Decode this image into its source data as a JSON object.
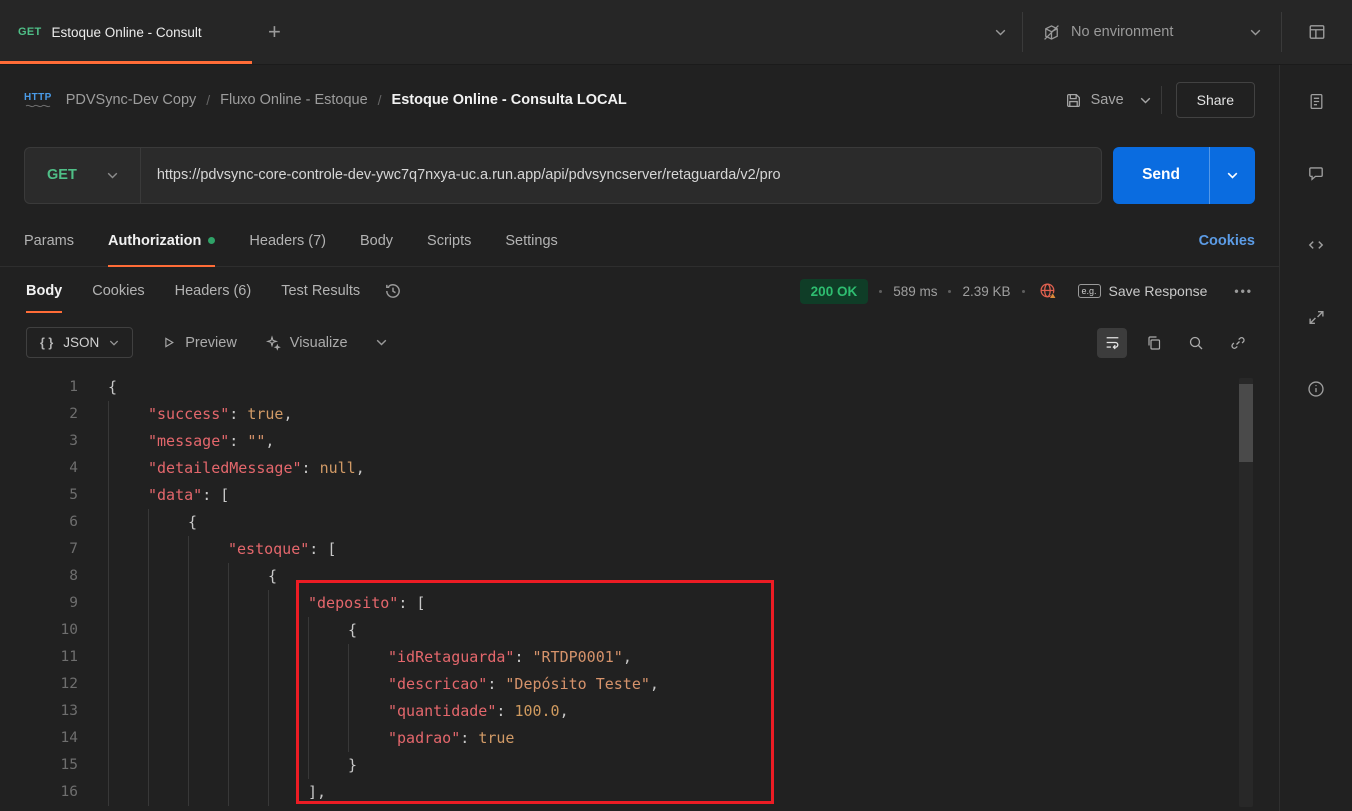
{
  "topbar": {
    "tab": {
      "method": "GET",
      "title": "Estoque Online - Consult"
    },
    "add_label": "+",
    "environment": {
      "label": "No environment"
    }
  },
  "breadcrumb": {
    "protocol": "HTTP",
    "separator": "/",
    "items": [
      "PDVSync-Dev Copy",
      "Fluxo Online - Estoque"
    ],
    "current": "Estoque Online - Consulta LOCAL",
    "save_label": "Save",
    "share_label": "Share"
  },
  "request": {
    "method": "GET",
    "url": "https://pdvsync-core-controle-dev-ywc7q7nxya-uc.a.run.app/api/pdvsyncserver/retaguarda/v2/pro",
    "send_label": "Send",
    "tabs": [
      {
        "label": "Params"
      },
      {
        "label": "Authorization",
        "active": true,
        "dot": true
      },
      {
        "label": "Headers (7)"
      },
      {
        "label": "Body"
      },
      {
        "label": "Scripts"
      },
      {
        "label": "Settings"
      }
    ],
    "cookies_link": "Cookies"
  },
  "response": {
    "tabs": [
      {
        "label": "Body",
        "active": true
      },
      {
        "label": "Cookies"
      },
      {
        "label": "Headers (6)"
      },
      {
        "label": "Test Results"
      }
    ],
    "status": "200 OK",
    "time": "589 ms",
    "size": "2.39 KB",
    "example_badge": "e.g.",
    "save_response_label": "Save Response",
    "more_label": "•••",
    "toolbar": {
      "format_icon": "{ }",
      "format_label": "JSON",
      "preview_label": "Preview",
      "visualize_label": "Visualize"
    }
  },
  "colors": {
    "accent_orange": "#ff6c37",
    "method_get_green": "#4fbf87",
    "send_button_blue": "#0a6ce0",
    "status_ok_green": "#2ebd70",
    "link_blue": "#5c9ce6",
    "highlight_red": "#ec1c24"
  },
  "code": {
    "highlight_note": "red box around deposito array, lines 9-16",
    "lines": [
      {
        "n": 1,
        "ind": 0,
        "tokens": [
          {
            "c": "pun",
            "t": "{"
          }
        ]
      },
      {
        "n": 2,
        "ind": 1,
        "tokens": [
          {
            "c": "key",
            "t": "\"success\""
          },
          {
            "c": "pun",
            "t": ": "
          },
          {
            "c": "bool",
            "t": "true"
          },
          {
            "c": "pun",
            "t": ","
          }
        ]
      },
      {
        "n": 3,
        "ind": 1,
        "tokens": [
          {
            "c": "key",
            "t": "\"message\""
          },
          {
            "c": "pun",
            "t": ": "
          },
          {
            "c": "str",
            "t": "\"\""
          },
          {
            "c": "pun",
            "t": ","
          }
        ]
      },
      {
        "n": 4,
        "ind": 1,
        "tokens": [
          {
            "c": "key",
            "t": "\"detailedMessage\""
          },
          {
            "c": "pun",
            "t": ": "
          },
          {
            "c": "null",
            "t": "null"
          },
          {
            "c": "pun",
            "t": ","
          }
        ]
      },
      {
        "n": 5,
        "ind": 1,
        "tokens": [
          {
            "c": "key",
            "t": "\"data\""
          },
          {
            "c": "pun",
            "t": ": ["
          }
        ]
      },
      {
        "n": 6,
        "ind": 2,
        "tokens": [
          {
            "c": "pun",
            "t": "{"
          }
        ]
      },
      {
        "n": 7,
        "ind": 3,
        "tokens": [
          {
            "c": "key",
            "t": "\"estoque\""
          },
          {
            "c": "pun",
            "t": ": ["
          }
        ]
      },
      {
        "n": 8,
        "ind": 4,
        "tokens": [
          {
            "c": "pun",
            "t": "{"
          }
        ]
      },
      {
        "n": 9,
        "ind": 5,
        "tokens": [
          {
            "c": "key",
            "t": "\"deposito\""
          },
          {
            "c": "pun",
            "t": ": ["
          }
        ]
      },
      {
        "n": 10,
        "ind": 6,
        "tokens": [
          {
            "c": "pun",
            "t": "{"
          }
        ]
      },
      {
        "n": 11,
        "ind": 7,
        "tokens": [
          {
            "c": "key",
            "t": "\"idRetaguarda\""
          },
          {
            "c": "pun",
            "t": ": "
          },
          {
            "c": "str",
            "t": "\"RTDP0001\""
          },
          {
            "c": "pun",
            "t": ","
          }
        ]
      },
      {
        "n": 12,
        "ind": 7,
        "tokens": [
          {
            "c": "key",
            "t": "\"descricao\""
          },
          {
            "c": "pun",
            "t": ": "
          },
          {
            "c": "str",
            "t": "\"Depósito Teste\""
          },
          {
            "c": "pun",
            "t": ","
          }
        ]
      },
      {
        "n": 13,
        "ind": 7,
        "tokens": [
          {
            "c": "key",
            "t": "\"quantidade\""
          },
          {
            "c": "pun",
            "t": ": "
          },
          {
            "c": "num",
            "t": "100.0"
          },
          {
            "c": "pun",
            "t": ","
          }
        ]
      },
      {
        "n": 14,
        "ind": 7,
        "tokens": [
          {
            "c": "key",
            "t": "\"padrao\""
          },
          {
            "c": "pun",
            "t": ": "
          },
          {
            "c": "bool",
            "t": "true"
          }
        ]
      },
      {
        "n": 15,
        "ind": 6,
        "tokens": [
          {
            "c": "pun",
            "t": "}"
          }
        ]
      },
      {
        "n": 16,
        "ind": 5,
        "tokens": [
          {
            "c": "pun",
            "t": "],"
          }
        ]
      }
    ]
  }
}
